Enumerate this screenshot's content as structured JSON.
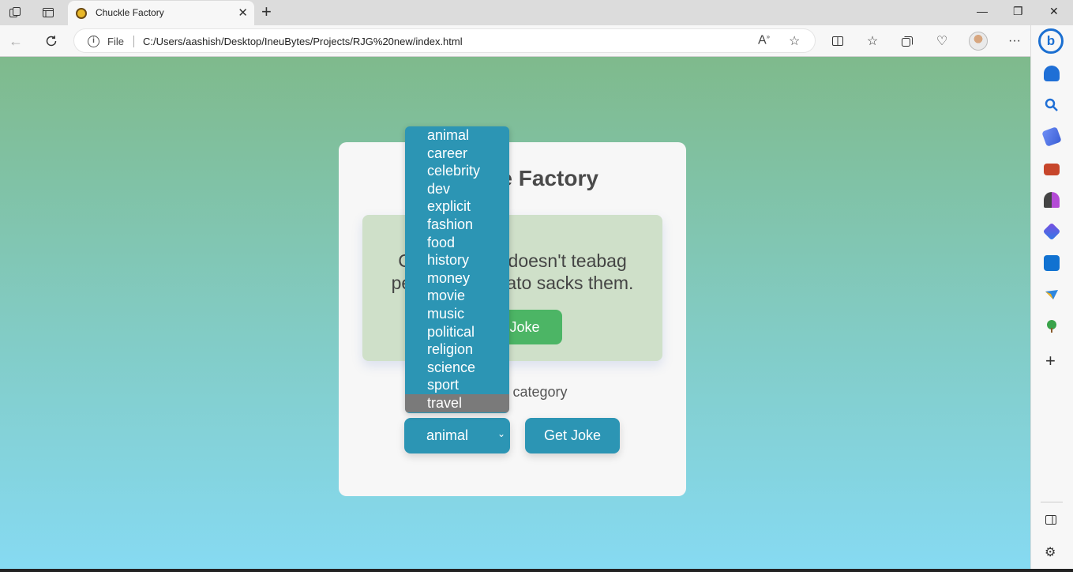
{
  "browser": {
    "tab_title": "Chuckle Factory",
    "file_label": "File",
    "url": "C:/Users/aashish/Desktop/IneuBytes/Projects/RJG%20new/index.html",
    "icons": [
      "workspaces-icon",
      "tab-actions-icon",
      "back-icon",
      "refresh-icon",
      "info-icon",
      "read-aloud-icon",
      "favorite-star-icon",
      "split-screen-icon",
      "favorites-icon",
      "collections-icon",
      "browser-essentials-icon",
      "profile-avatar",
      "more-icon",
      "bing-icon"
    ]
  },
  "sidebar": {
    "icons": [
      "bell-icon",
      "search-icon",
      "tag-icon",
      "briefcase-icon",
      "games-icon",
      "office-icon",
      "outlook-icon",
      "send-icon",
      "tree-icon",
      "add-icon",
      "sidebar-toggle-icon",
      "settings-icon"
    ]
  },
  "page": {
    "title": "Chuckle Factory",
    "joke": "Chuck Norris doesn't teabag people, he potato sacks them.",
    "tweet_button": "Tweet Joke",
    "category_label": "Select a category",
    "selected_category": "animal",
    "get_joke_button": "Get Joke",
    "categories": [
      "animal",
      "career",
      "celebrity",
      "dev",
      "explicit",
      "fashion",
      "food",
      "history",
      "money",
      "movie",
      "music",
      "political",
      "religion",
      "science",
      "sport",
      "travel"
    ],
    "highlighted_category": "travel",
    "colors": {
      "accent": "#2c95b4",
      "tweet_green": "#4cb565",
      "joke_bg": "#cfe0c9",
      "gradient_top": "#7fba8c",
      "gradient_bottom": "#86daf2"
    }
  }
}
